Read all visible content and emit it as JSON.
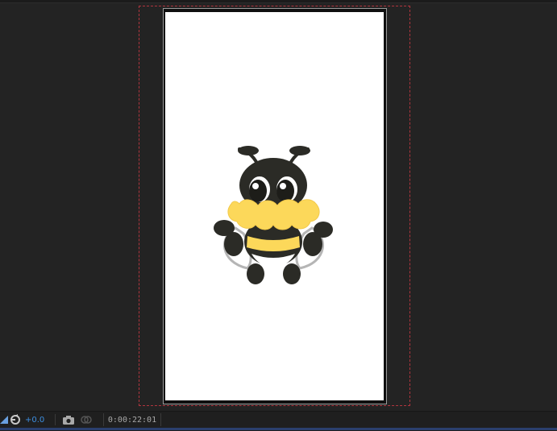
{
  "composition_viewer": {
    "footer": {
      "exposure_value": "+0.0",
      "current_time": "0:00:22:01"
    },
    "icons": {
      "exposure": "adjust-exposure-icon",
      "reset_exposure": "reset-exposure-icon",
      "snapshot": "camera-icon",
      "show_snapshot": "show-snapshot-icon"
    },
    "colors": {
      "background": "#232323",
      "canvas": "#ffffff",
      "safe_zone_guide": "#b0353e",
      "exposure_value": "#3d8ee0",
      "bee_yellow": "#fcd85a",
      "bee_dark": "#2b2b26"
    }
  }
}
